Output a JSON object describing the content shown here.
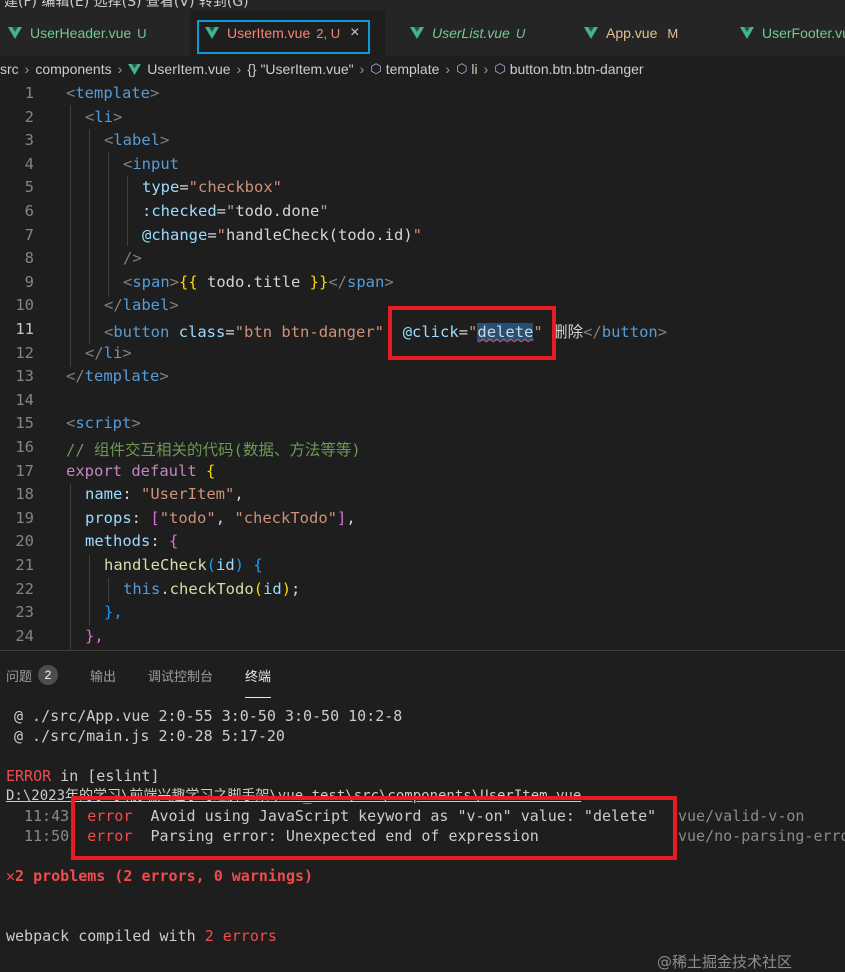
{
  "window": {
    "title_fragment": "建(F) 编辑(E) 选择(S) 查看(V) 转到(G)"
  },
  "tabs": [
    {
      "label": "UserHeader.vue",
      "badge": "U",
      "color": "#73c991",
      "italic": false,
      "active": false
    },
    {
      "label": "UserItem.vue",
      "badge": "2, U",
      "color": "#f48771",
      "italic": false,
      "active": true,
      "close": "×"
    },
    {
      "label": "UserList.vue",
      "badge": "U",
      "color": "#73c991",
      "italic": true,
      "active": false
    },
    {
      "label": "App.vue",
      "badge": "M",
      "color": "#e2c08d",
      "italic": false,
      "active": false
    },
    {
      "label": "UserFooter.vue",
      "badge": "",
      "color": "#73c991",
      "italic": false,
      "active": false
    }
  ],
  "breadcrumb": [
    "src",
    "components",
    "UserItem.vue",
    "{} \"UserItem.vue\"",
    "template",
    "li",
    "button.btn.btn-danger"
  ],
  "editor": {
    "current_line": 11,
    "lines": [
      {
        "n": "1"
      },
      {
        "n": "2"
      },
      {
        "n": "3"
      },
      {
        "n": "4"
      },
      {
        "n": "5"
      },
      {
        "n": "6"
      },
      {
        "n": "7"
      },
      {
        "n": "8"
      },
      {
        "n": "9"
      },
      {
        "n": "10"
      },
      {
        "n": "11"
      },
      {
        "n": "12"
      },
      {
        "n": "13"
      },
      {
        "n": "14"
      },
      {
        "n": "15"
      },
      {
        "n": "16"
      },
      {
        "n": "17"
      },
      {
        "n": "18"
      },
      {
        "n": "19"
      },
      {
        "n": "20"
      },
      {
        "n": "21"
      },
      {
        "n": "22"
      },
      {
        "n": "23"
      },
      {
        "n": "24"
      }
    ],
    "code": {
      "l1_tag": "template",
      "l2_tag": "li",
      "l3_tag": "label",
      "l4_tag": "input",
      "l5_attr": "type",
      "l5_val": "\"checkbox\"",
      "l6_attr": ":checked",
      "l6_val": "\"",
      "l6_expr": "todo.done",
      "l6_end": "\"",
      "l7_attr": "@change",
      "l7_val": "\"",
      "l7_expr": "handleCheck(todo.id)",
      "l7_end": "\"",
      "l8_close": "/>",
      "l9_tag": "span",
      "l9_mus_open": "{{",
      "l9_expr": " todo.title ",
      "l9_mus_close": "}}",
      "l9_end_tag": "span",
      "l10_tag": "label",
      "l11_tag": "button",
      "l11_attr": "class",
      "l11_val": "\"btn btn-danger\"",
      "l11_attr2": "@click",
      "l11_q1": "\"",
      "l11_err": "delete",
      "l11_q2": "\"",
      "l11_text": "删除",
      "l11_end_tag": "button",
      "l12_tag": "li",
      "l13_tag": "template",
      "l15_tag": "script",
      "l16_comment": "// 组件交互相关的代码(数据、方法等等)",
      "l17_kw1": "export",
      "l17_kw2": "default",
      "l17_brace": "{",
      "l18_key": "name",
      "l18_val": "\"UserItem\"",
      "l19_key": "props",
      "l19_v1": "\"todo\"",
      "l19_v2": "\"checkTodo\"",
      "l20_key": "methods",
      "l20_brace": "{",
      "l21_fn": "handleCheck",
      "l21_param": "id",
      "l21_brace": "{",
      "l22_this": "this",
      "l22_fn": "checkTodo",
      "l22_arg": "id",
      "l23_close": "},",
      "l24_close": "},"
    }
  },
  "panel": {
    "tabs": [
      {
        "label": "问题",
        "count": "2",
        "active": false
      },
      {
        "label": "输出",
        "active": false
      },
      {
        "label": "调试控制台",
        "active": false
      },
      {
        "label": "终端",
        "active": true
      }
    ],
    "terminal": {
      "l1": "@ ./src/App.vue 2:0-55 3:0-50 3:0-50 10:2-8",
      "l2": "@ ./src/main.js 2:0-28 5:17-20",
      "l3_error": "ERROR",
      "l3_rest": " in [eslint]",
      "l4": "D:\\2023年的学习\\前端兴趣学习之脚手架\\vue_test\\src\\components\\UserItem.vue",
      "e1_time": "11:43",
      "e1_sev": "error",
      "e1_msg": "Avoid using JavaScript keyword as \"v-on\" value: \"delete\"",
      "e1_rule": "vue/valid-v-on",
      "e2_time": "11:50",
      "e2_sev": "error",
      "e2_msg": "Parsing error: Unexpected end of expression",
      "e2_rule": "vue/no-parsing-error",
      "summary_icon": "✕",
      "summary": "2 problems (2 errors, 0 warnings)",
      "compiled_prefix": "webpack compiled with ",
      "compiled_count": "2 errors"
    },
    "watermark": "@稀土掘金技术社区"
  }
}
